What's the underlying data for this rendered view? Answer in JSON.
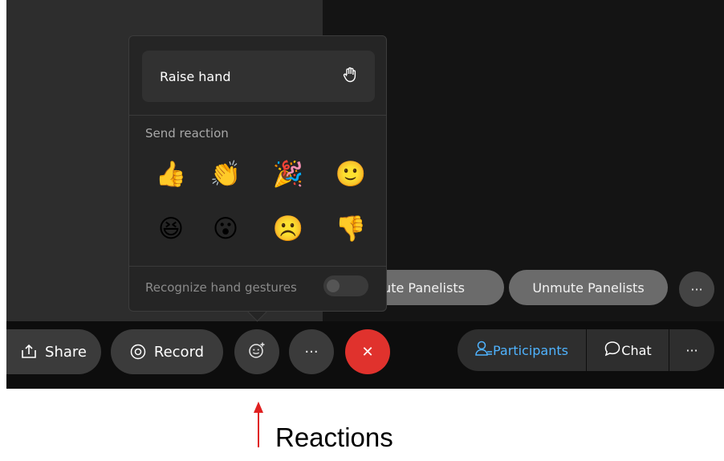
{
  "popup": {
    "raise_hand_label": "Raise hand",
    "send_reaction_label": "Send reaction",
    "reactions": [
      "👍",
      "👏",
      "🎉",
      "🙂",
      "😆",
      "😮",
      "☹️",
      "👎"
    ],
    "gestures_label": "Recognize hand gestures",
    "gestures_enabled": false
  },
  "panelist_buttons": {
    "mute_label": "ute Panelists",
    "unmute_label": "Unmute Panelists",
    "more_label": "···"
  },
  "toolbar": {
    "share_label": "Share",
    "record_label": "Record",
    "more_label": "···",
    "end_label": "✕",
    "participants_label": "Participants",
    "chat_label": "Chat",
    "panel_more_label": "···"
  },
  "annotation": {
    "label": "Reactions"
  },
  "colors": {
    "accent": "#4fb3ff",
    "end_call": "#e0322d",
    "annotation_arrow": "#e02020"
  }
}
